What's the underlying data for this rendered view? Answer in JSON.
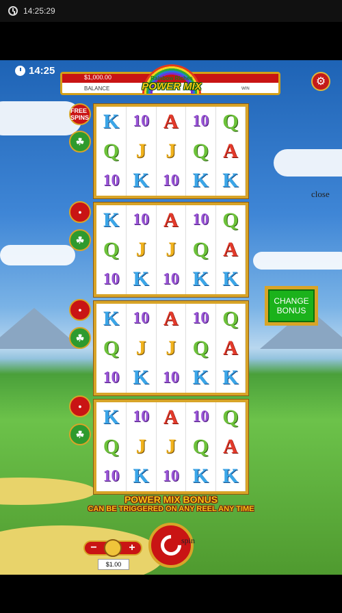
{
  "status_bar": {
    "time": "14:25:29"
  },
  "game_clock": "14:25",
  "balance": {
    "value": "$1,000.00",
    "label": "BALANCE",
    "win_label": "WIN"
  },
  "logo": {
    "line1": "Rainbow Riches",
    "line2": "POWER MIX"
  },
  "close_label": "close",
  "side_buttons": [
    {
      "icon": "free-spins-icon",
      "label": "FREE SPINS"
    },
    {
      "icon": "clover-icon",
      "label": "☘"
    },
    {
      "icon": "pot-icon",
      "label": "●"
    },
    {
      "icon": "clover-icon",
      "label": "☘"
    },
    {
      "icon": "leprechaun-icon",
      "label": "●"
    },
    {
      "icon": "clover-icon",
      "label": "☘"
    },
    {
      "icon": "mushroom-icon",
      "label": "●"
    },
    {
      "icon": "clover-icon",
      "label": "☘"
    }
  ],
  "reels": [
    [
      [
        "K",
        "10",
        "A",
        "10",
        "Q"
      ],
      [
        "Q",
        "J",
        "J",
        "Q",
        "A"
      ],
      [
        "10",
        "K",
        "10",
        "K",
        "K"
      ]
    ],
    [
      [
        "K",
        "10",
        "A",
        "10",
        "Q"
      ],
      [
        "Q",
        "J",
        "J",
        "Q",
        "A"
      ],
      [
        "10",
        "K",
        "10",
        "K",
        "K"
      ]
    ],
    [
      [
        "K",
        "10",
        "A",
        "10",
        "Q"
      ],
      [
        "Q",
        "J",
        "J",
        "Q",
        "A"
      ],
      [
        "10",
        "K",
        "10",
        "K",
        "K"
      ]
    ],
    [
      [
        "K",
        "10",
        "A",
        "10",
        "Q"
      ],
      [
        "Q",
        "J",
        "J",
        "Q",
        "A"
      ],
      [
        "10",
        "K",
        "10",
        "K",
        "K"
      ]
    ]
  ],
  "change_bonus": {
    "label_line1": "CHANGE",
    "label_line2": "BONUS"
  },
  "bonus_message": {
    "title": "POWER MIX BONUS",
    "subtitle": "CAN BE TRIGGERED ON ANY REEL ANY TIME"
  },
  "stake": {
    "minus": "−",
    "plus": "+",
    "value": "$1.00"
  },
  "spin_label": "spin"
}
